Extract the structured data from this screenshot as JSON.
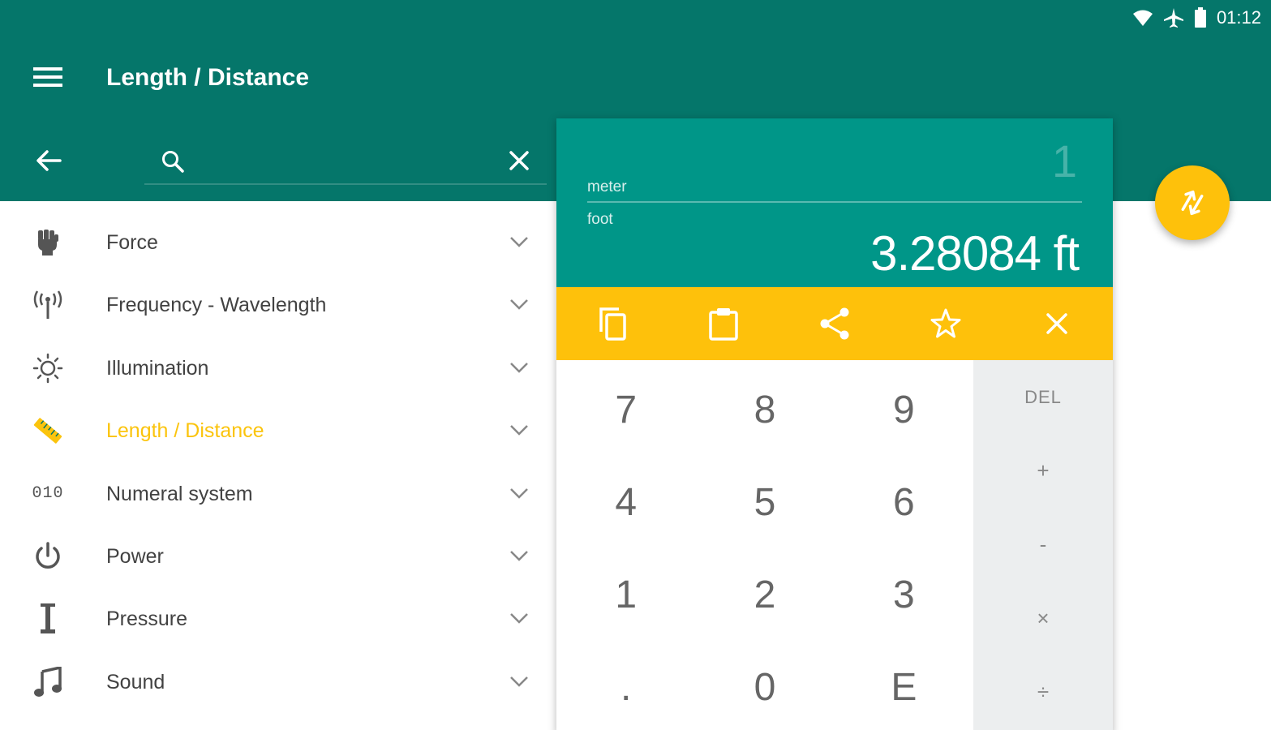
{
  "status_bar": {
    "time": "01:12"
  },
  "header": {
    "title": "Length / Distance"
  },
  "search": {
    "placeholder": "",
    "value": ""
  },
  "categories": [
    {
      "label": "Force",
      "icon": "fist-icon",
      "active": false
    },
    {
      "label": "Frequency - Wavelength",
      "icon": "antenna-icon",
      "active": false
    },
    {
      "label": "Illumination",
      "icon": "sun-icon",
      "active": false
    },
    {
      "label": "Length / Distance",
      "icon": "ruler-icon",
      "active": true
    },
    {
      "label": "Numeral system",
      "icon": "binary-icon",
      "icon_text": "010",
      "active": false
    },
    {
      "label": "Power",
      "icon": "power-icon",
      "active": false
    },
    {
      "label": "Pressure",
      "icon": "pressure-icon",
      "active": false
    },
    {
      "label": "Sound",
      "icon": "music-note-icon",
      "active": false
    }
  ],
  "converter": {
    "input_value": "1",
    "from_unit": "meter",
    "to_unit": "foot",
    "result": "3.28084 ft",
    "actions": [
      "copy-icon",
      "clipboard-icon",
      "share-icon",
      "star-icon",
      "close-icon"
    ],
    "digits": [
      "7",
      "8",
      "9",
      "4",
      "5",
      "6",
      "1",
      "2",
      "3",
      ".",
      "0",
      "E"
    ],
    "operators": [
      "DEL",
      "+",
      "-",
      "×",
      "÷"
    ]
  },
  "colors": {
    "primary_dark": "#05766a",
    "primary": "#009688",
    "accent": "#fec10b",
    "active_text": "#fbc40d",
    "keypad_ops_bg": "#eceeef"
  }
}
